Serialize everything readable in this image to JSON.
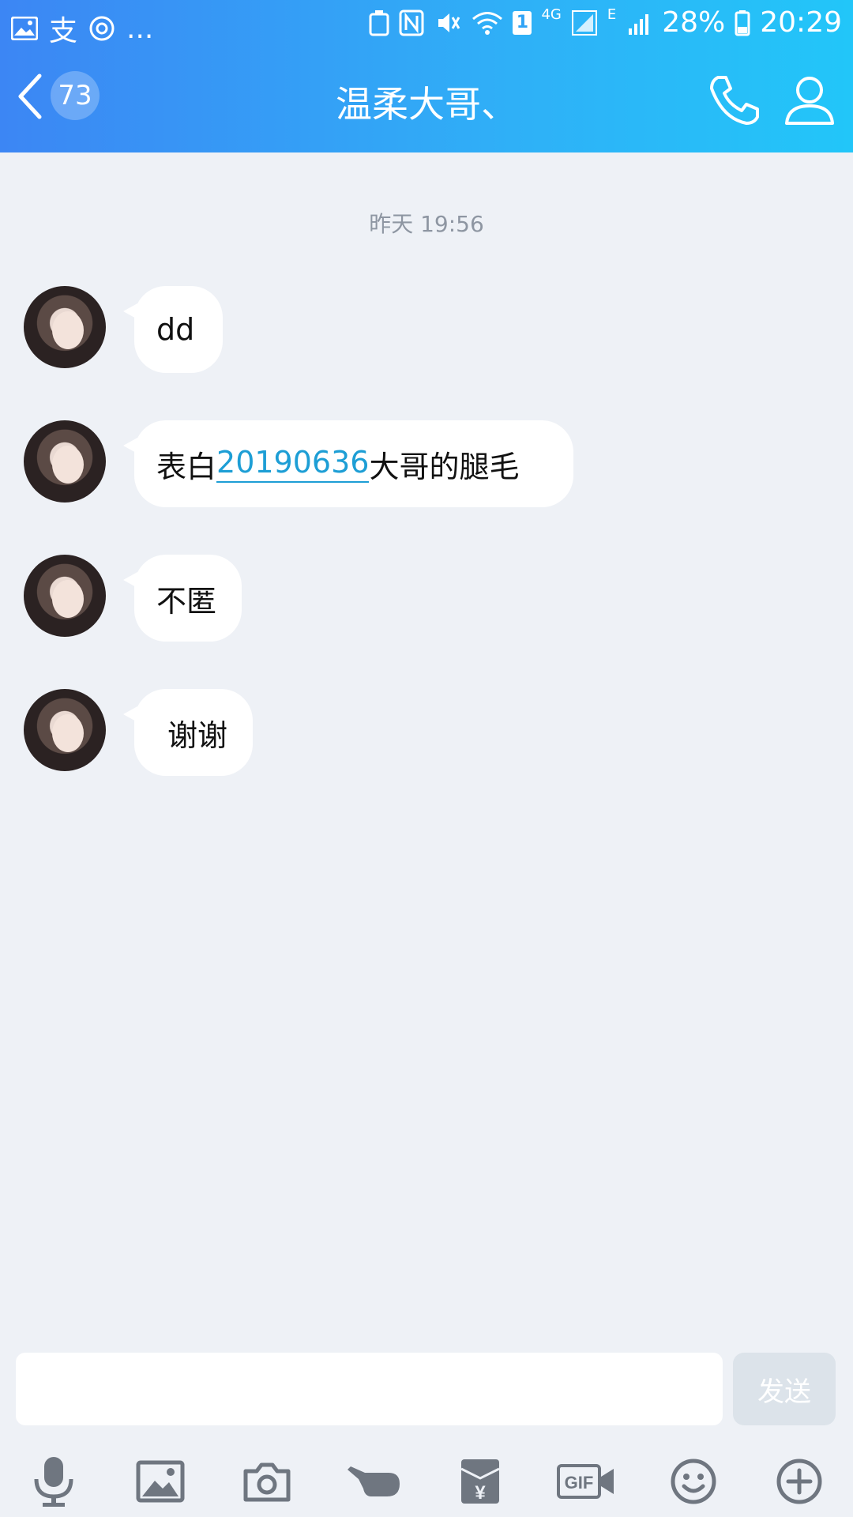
{
  "status_bar": {
    "dots": "...",
    "zhi_char": "支",
    "sim_label": "1",
    "network_4g": "4G",
    "network_e": "E",
    "battery": "28%",
    "time": "20:29"
  },
  "header": {
    "back_count": "73",
    "title": "温柔大哥、"
  },
  "chat": {
    "timestamp": "昨天 19:56",
    "messages": [
      {
        "text": "dd"
      },
      {
        "prefix": "表白",
        "link": "20190636",
        "suffix": "大哥的腿毛"
      },
      {
        "text": "不匿"
      },
      {
        "text": "谢谢"
      }
    ]
  },
  "composer": {
    "input_value": "",
    "send_label": "发送"
  },
  "toolbar": {
    "gif_label": "GIF",
    "yen_label": "¥"
  },
  "colors": {
    "header_gradient_start": "#3c86f4",
    "header_gradient_end": "#22c6f9",
    "chat_background": "#eef1f6",
    "link": "#1d9ed5",
    "icon_gray": "#6f7680"
  }
}
